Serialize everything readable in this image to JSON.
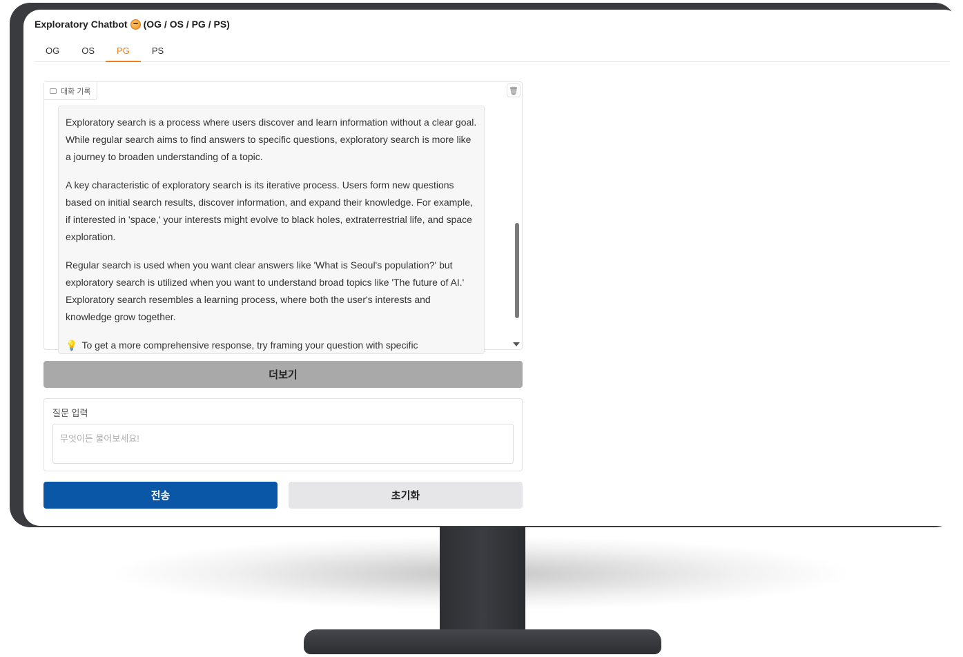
{
  "app": {
    "title": "Exploratory Chatbot",
    "title_suffix": "(OG / OS / PG / PS)"
  },
  "tabs": [
    {
      "label": "OG",
      "active": false
    },
    {
      "label": "OS",
      "active": false
    },
    {
      "label": "PG",
      "active": true
    },
    {
      "label": "PS",
      "active": false
    }
  ],
  "chat": {
    "label": "대화 기록",
    "message": {
      "paragraphs": [
        "Exploratory search is a process where users discover and learn information without a clear goal. While regular search aims to find answers to specific questions, exploratory search is more like a journey to broaden understanding of a topic.",
        "A key characteristic of exploratory search is its iterative process. Users form new questions based on initial search results, discover information, and expand their knowledge. For example, if interested in 'space,' your interests might evolve to black holes, extraterrestrial life, and space exploration.",
        "Regular search is used when you want clear answers like 'What is Seoul's population?' but exploratory search is utilized when you want to understand broad topics like 'The future of AI.' Exploratory search resembles a learning process, where both the user's interests and knowledge grow together."
      ],
      "hint": "To get a more comprehensive response, try framing your question with specific"
    }
  },
  "more_button": {
    "label": "더보기"
  },
  "input": {
    "label": "질문 입력",
    "placeholder": "무엇이든 물어보세요!",
    "value": ""
  },
  "actions": {
    "send_label": "전송",
    "reset_label": "초기화"
  },
  "colors": {
    "accent": "#f07d1a",
    "primary_button": "#0a57a8",
    "more_button": "#a9a9a9",
    "secondary_button": "#e6e6e8"
  },
  "icons": [
    "emoji-icon",
    "chat-icon",
    "trash-icon",
    "bulb-icon",
    "scroll-down-icon"
  ]
}
